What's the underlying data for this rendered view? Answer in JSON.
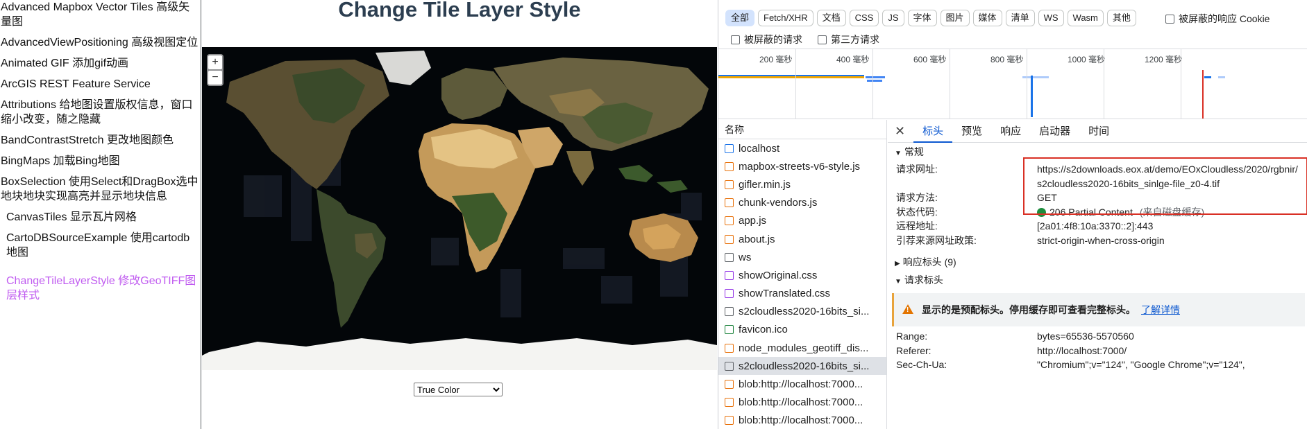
{
  "sidebar": {
    "items": [
      {
        "label": "Advanced Mapbox Vector Tiles 高级矢量图",
        "indent": false
      },
      {
        "label": "AdvancedViewPositioning 高级视图定位",
        "indent": false
      },
      {
        "label": "Animated GIF 添加gif动画",
        "indent": false
      },
      {
        "label": "ArcGIS REST Feature Service",
        "indent": false
      },
      {
        "label": "Attributions 给地图设置版权信息，窗口缩小改变，随之隐藏",
        "indent": false
      },
      {
        "label": "BandContrastStretch 更改地图颜色",
        "indent": false
      },
      {
        "label": "BingMaps 加载Bing地图",
        "indent": false
      },
      {
        "label": "BoxSelection 使用Select和DragBox选中地块地块实现高亮并显示地块信息",
        "indent": false
      },
      {
        "label": "CanvasTiles 显示瓦片网格",
        "indent": true
      },
      {
        "label": "CartoDBSourceExample 使用cartodb地图",
        "indent": true
      },
      {
        "label": "ChangeTileLayerStyle 修改GeoTIFF图层样式",
        "indent": true,
        "active": true
      }
    ]
  },
  "page": {
    "title": "Change Tile Layer Style",
    "zoom_in": "+",
    "zoom_out": "−",
    "select_value": "True Color",
    "select_options": [
      "True Color"
    ]
  },
  "devtools": {
    "filters": [
      "全部",
      "Fetch/XHR",
      "文档",
      "CSS",
      "JS",
      "字体",
      "图片",
      "媒体",
      "清单",
      "WS",
      "Wasm",
      "其他"
    ],
    "blocked_cookies_label": "被屏蔽的响应 Cookie",
    "blocked_requests_label": "被屏蔽的请求",
    "third_party_label": "第三方请求",
    "timeline_ticks": [
      "200 毫秒",
      "400 毫秒",
      "600 毫秒",
      "800 毫秒",
      "1000 毫秒",
      "1200 毫秒"
    ],
    "list_header": "名称",
    "requests": [
      {
        "name": "localhost",
        "icon": "document-icon",
        "color": "#1a73e8"
      },
      {
        "name": "mapbox-streets-v6-style.js",
        "icon": "script-icon",
        "color": "#e8710a"
      },
      {
        "name": "gifler.min.js",
        "icon": "script-icon",
        "color": "#e8710a"
      },
      {
        "name": "chunk-vendors.js",
        "icon": "script-icon",
        "color": "#e8710a"
      },
      {
        "name": "app.js",
        "icon": "script-icon",
        "color": "#e8710a"
      },
      {
        "name": "about.js",
        "icon": "script-icon",
        "color": "#e8710a"
      },
      {
        "name": "ws",
        "icon": "websocket-icon",
        "color": "#5f6368"
      },
      {
        "name": "showOriginal.css",
        "icon": "stylesheet-icon",
        "color": "#9334e6"
      },
      {
        "name": "showTranslated.css",
        "icon": "stylesheet-icon",
        "color": "#9334e6"
      },
      {
        "name": "s2cloudless2020-16bits_si...",
        "icon": "image-icon",
        "color": "#5f6368"
      },
      {
        "name": "favicon.ico",
        "icon": "favicon-icon",
        "color": "#188038"
      },
      {
        "name": "node_modules_geotiff_dis...",
        "icon": "script-icon",
        "color": "#e8710a"
      },
      {
        "name": "s2cloudless2020-16bits_si...",
        "icon": "image-icon",
        "color": "#5f6368",
        "selected": true
      },
      {
        "name": "blob:http://localhost:7000...",
        "icon": "script-icon",
        "color": "#e8710a"
      },
      {
        "name": "blob:http://localhost:7000...",
        "icon": "script-icon",
        "color": "#e8710a"
      },
      {
        "name": "blob:http://localhost:7000...",
        "icon": "script-icon",
        "color": "#e8710a"
      }
    ],
    "tabs": [
      "标头",
      "预览",
      "响应",
      "启动器",
      "时间"
    ],
    "general_title": "常规",
    "general": [
      {
        "k": "请求网址:",
        "v": "https://s2downloads.eox.at/demo/EOxCloudless/2020/rgbnir/s2cloudless2020-16bits_sinlge-file_z0-4.tif"
      },
      {
        "k": "请求方法:",
        "v": "GET"
      },
      {
        "k": "状态代码:",
        "v": "206 Partial Content",
        "note": "(来自磁盘缓存)"
      },
      {
        "k": "远程地址:",
        "v": "[2a01:4f8:10a:3370::2]:443"
      },
      {
        "k": "引荐来源网址政策:",
        "v": "strict-origin-when-cross-origin"
      }
    ],
    "response_headers_title": "响应标头 (9)",
    "request_headers_title": "请求标头",
    "warning_text": "显示的是预配标头。停用缓存即可查看完整标头。",
    "warning_link": "了解详情",
    "request_headers": [
      {
        "k": "Range:",
        "v": "bytes=65536-5570560"
      },
      {
        "k": "Referer:",
        "v": "http://localhost:7000/"
      },
      {
        "k": "Sec-Ch-Ua:",
        "v": "\"Chromium\";v=\"124\", \"Google Chrome\";v=\"124\","
      }
    ]
  }
}
